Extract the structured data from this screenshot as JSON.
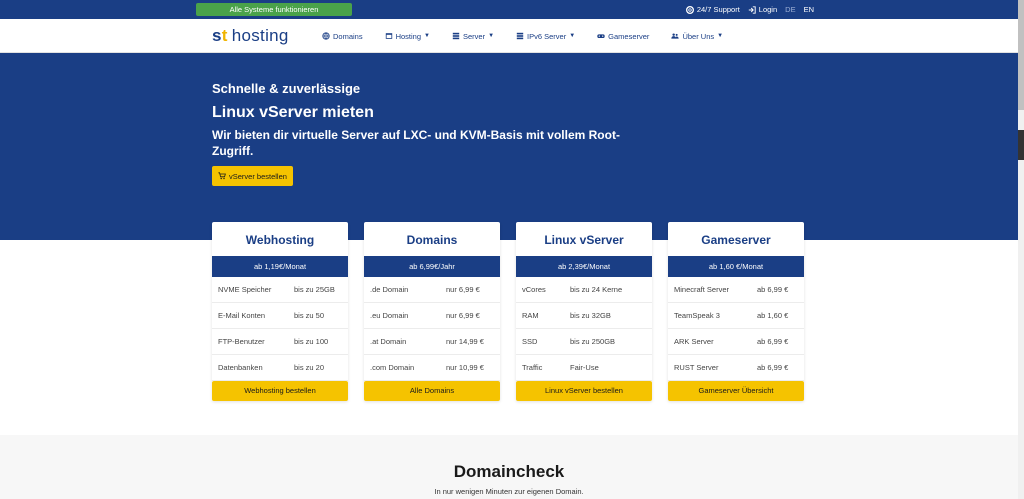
{
  "topbar": {
    "status": "Alle Systeme funktionieren",
    "support": "24/7 Support",
    "login": "Login",
    "lang_de": "DE",
    "lang_en": "EN"
  },
  "logo": {
    "brand": "hosting"
  },
  "nav": {
    "domains": "Domains",
    "hosting": "Hosting",
    "server": "Server",
    "ipv6": "IPv6 Server",
    "gameserver": "Gameserver",
    "about": "Über Uns"
  },
  "hero": {
    "line1": "Schnelle & zuverlässige",
    "line2": "Linux vServer mieten",
    "line3": "Wir bieten dir virtuelle Server auf LXC- und KVM-Basis mit vollem Root-Zugriff.",
    "button": "vServer bestellen"
  },
  "cards": [
    {
      "title": "Webhosting",
      "price": "ab 1,19€/Monat",
      "rows": [
        {
          "k": "NVME Speicher",
          "v": "bis zu 25GB"
        },
        {
          "k": "E-Mail Konten",
          "v": "bis zu 50"
        },
        {
          "k": "FTP-Benutzer",
          "v": "bis zu 100"
        },
        {
          "k": "Datenbanken",
          "v": "bis zu 20"
        }
      ],
      "button": "Webhosting bestellen"
    },
    {
      "title": "Domains",
      "price": "ab 6,99€/Jahr",
      "rows": [
        {
          "k": ".de Domain",
          "v": "nur 6,99 €"
        },
        {
          "k": ".eu Domain",
          "v": "nur 6,99 €"
        },
        {
          "k": ".at Domain",
          "v": "nur 14,99 €"
        },
        {
          "k": ".com Domain",
          "v": "nur 10,99 €"
        }
      ],
      "button": "Alle Domains"
    },
    {
      "title": "Linux vServer",
      "price": "ab 2,39€/Monat",
      "rows": [
        {
          "k": "vCores",
          "v": "bis zu 24 Kerne"
        },
        {
          "k": "RAM",
          "v": "bis zu 32GB"
        },
        {
          "k": "SSD",
          "v": "bis zu 250GB"
        },
        {
          "k": "Traffic",
          "v": "Fair-Use"
        }
      ],
      "button": "Linux vServer bestellen"
    },
    {
      "title": "Gameserver",
      "price": "ab 1,60 €/Monat",
      "rows": [
        {
          "k": "Minecraft Server",
          "v": "ab 6,99 €"
        },
        {
          "k": "TeamSpeak 3",
          "v": "ab 1,60 €"
        },
        {
          "k": "ARK Server",
          "v": "ab 6,99 €"
        },
        {
          "k": "RUST Server",
          "v": "ab 6,99 €"
        }
      ],
      "button": "Gameserver Übersicht"
    }
  ],
  "domaincheck": {
    "title": "Domaincheck",
    "subtitle": "In nur wenigen Minuten zur eigenen Domain."
  },
  "colors": {
    "primary": "#1a3e85",
    "accent": "#f5c300",
    "status": "#4aa24a"
  }
}
